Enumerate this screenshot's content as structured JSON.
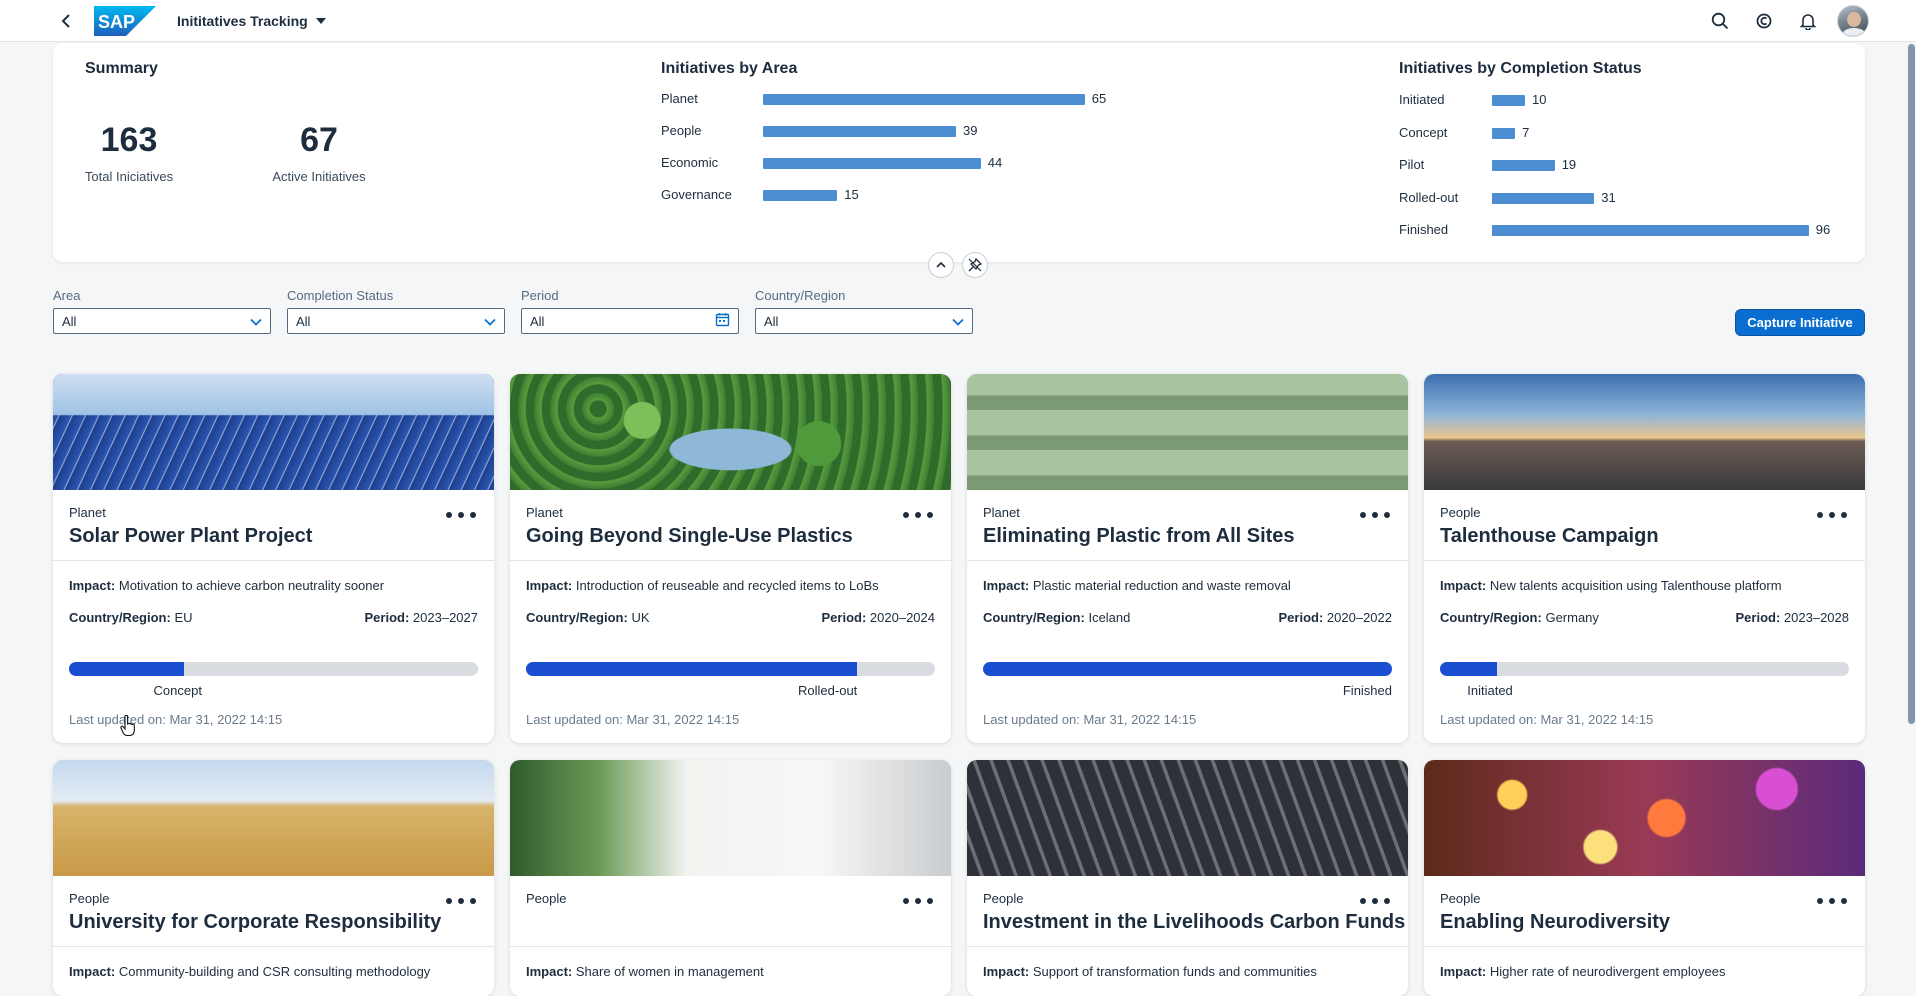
{
  "shell": {
    "app_title": "Inititatives Tracking",
    "logo_text": "SAP"
  },
  "summary": {
    "title": "Summary",
    "kpis": [
      {
        "value": "163",
        "label": "Total Iniciatives"
      },
      {
        "value": "67",
        "label": "Active Initiatives"
      }
    ],
    "by_area": {
      "title": "Initiatives by Area",
      "items": [
        {
          "label": "Planet",
          "value": 65
        },
        {
          "label": "People",
          "value": 39
        },
        {
          "label": "Economic",
          "value": 44
        },
        {
          "label": "Governance",
          "value": 15
        }
      ]
    },
    "by_status": {
      "title": "Initiatives by Completion Status",
      "items": [
        {
          "label": "Initiated",
          "value": 10
        },
        {
          "label": "Concept",
          "value": 7
        },
        {
          "label": "Pilot",
          "value": 19
        },
        {
          "label": "Rolled-out",
          "value": 31
        },
        {
          "label": "Finished",
          "value": 96
        }
      ]
    }
  },
  "filters": [
    {
      "label": "Area",
      "value": "All",
      "icon": "chevron-down-icon"
    },
    {
      "label": "Completion Status",
      "value": "All",
      "icon": "chevron-down-icon"
    },
    {
      "label": "Period",
      "value": "All",
      "icon": "calendar-icon"
    },
    {
      "label": "Country/Region",
      "value": "All",
      "icon": "chevron-down-icon"
    }
  ],
  "capture_label": "Capture Initiative",
  "labels": {
    "impact": "Impact:",
    "country": "Country/Region:",
    "period": "Period:"
  },
  "cards": [
    {
      "area": "Planet",
      "title": "Solar Power Plant Project",
      "impact": "Motivation to achieve carbon neutrality sooner",
      "country": "EU",
      "period": "2023–2027",
      "progress": 0.28,
      "status": "Concept",
      "updated": "Last updated on: Mar 31, 2022 14:15"
    },
    {
      "area": "Planet",
      "title": "Going Beyond Single-Use Plastics",
      "impact": "Introduction of reuseable and recycled items to LoBs",
      "country": "UK",
      "period": "2020–2024",
      "progress": 0.81,
      "status": "Rolled-out",
      "updated": "Last updated on: Mar 31, 2022 14:15"
    },
    {
      "area": "Planet",
      "title": "Eliminating Plastic from All Sites",
      "impact": "Plastic material reduction and waste removal",
      "country": "Iceland",
      "period": "2020–2022",
      "progress": 1.0,
      "status": "Finished",
      "updated": "Last updated on: Mar 31, 2022 14:15"
    },
    {
      "area": "People",
      "title": "Talenthouse Campaign",
      "impact": "New talents acquisition using Talenthouse platform",
      "country": "Germany",
      "period": "2023–2028",
      "progress": 0.14,
      "status": "Initiated",
      "updated": "Last updated on: Mar 31, 2022 14:15"
    },
    {
      "area": "People",
      "title": "University for Corporate Responsibility",
      "impact": "Community-building and CSR consulting methodology"
    },
    {
      "area": "People",
      "title": "",
      "impact": "Share of women in management"
    },
    {
      "area": "People",
      "title": "Investment in the Livelihoods Carbon Funds",
      "impact": "Support of transformation funds and communities"
    },
    {
      "area": "People",
      "title": "Enabling Neurodiversity",
      "impact": "Higher rate of neurodivergent employees"
    }
  ]
}
